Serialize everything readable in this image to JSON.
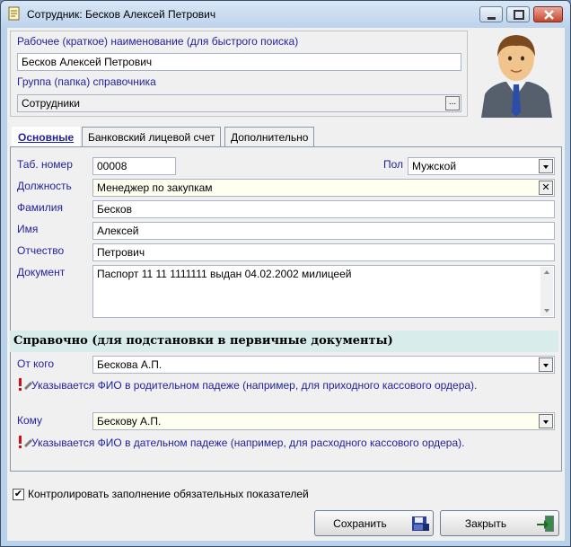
{
  "window": {
    "title": "Сотрудник: Бесков Алексей Петрович"
  },
  "header": {
    "short_name_label": "Рабочее (краткое) наименование (для быстрого поиска)",
    "short_name_value": "Бесков Алексей Петрович",
    "group_label": "Группа (папка) справочника",
    "group_value": "Сотрудники",
    "browse_label": "..."
  },
  "tabs": [
    {
      "label": "Основные"
    },
    {
      "label": "Банковский лицевой счет"
    },
    {
      "label": "Дополнительно"
    }
  ],
  "form": {
    "tab_number_label": "Таб. номер",
    "tab_number_value": "00008",
    "gender_label": "Пол",
    "gender_value": "Мужской",
    "position_label": "Должность",
    "position_value": "Менеджер по закупкам",
    "surname_label": "Фамилия",
    "surname_value": "Бесков",
    "name_label": "Имя",
    "name_value": "Алексей",
    "patronymic_label": "Отчество",
    "patronymic_value": "Петрович",
    "document_label": "Документ",
    "document_value": "Паспорт 11 11 1111111 выдан 04.02.2002 милицеей"
  },
  "reference": {
    "section_title": "Справочно (для подстановки в первичные документы)",
    "from_label": "От кого",
    "from_value": "Бескова А.П.",
    "from_hint": "Указывается ФИО в родительном падеже (например, для приходного кассового ордера).",
    "to_label": "Кому",
    "to_value": "Бескову А.П.",
    "to_hint": "Указывается ФИО в дательном падеже (например, для расходного кассового ордера)."
  },
  "footer": {
    "check_label": "Контролировать заполнение обязательных показателей",
    "check_checked": true,
    "save_label": "Сохранить",
    "close_label": "Закрыть"
  },
  "colors": {
    "label": "#1f1f9f",
    "section_bg": "#d9ecec",
    "window_frame": "#b9d1ea"
  }
}
